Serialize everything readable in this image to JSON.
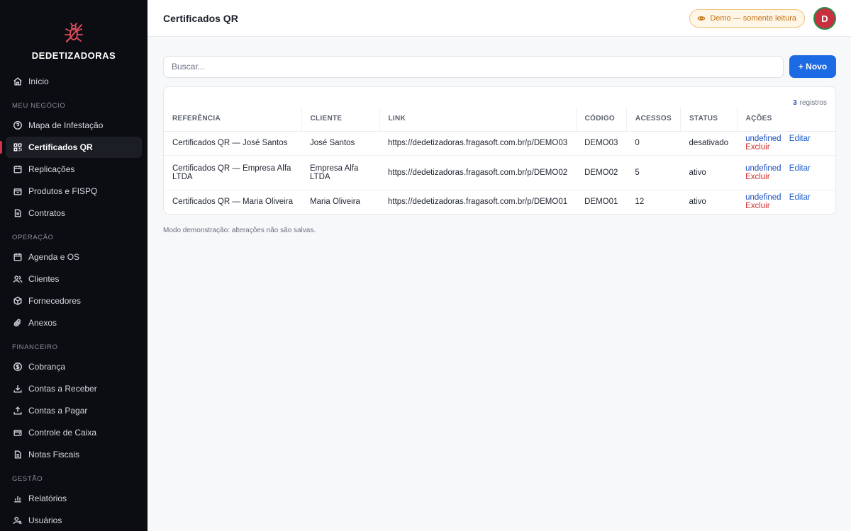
{
  "brand": {
    "name": "DEDETIZADORAS",
    "accent": "#d6314a"
  },
  "sidebar": {
    "home": {
      "label": "Início",
      "icon": "home-icon"
    },
    "sections": [
      {
        "title": "MEU NEGÓCIO",
        "items": [
          {
            "label": "Mapa de Infestação",
            "icon": "help-circle-icon"
          },
          {
            "label": "Certificados QR",
            "icon": "qr-grid-icon",
            "active": true
          },
          {
            "label": "Replicações",
            "icon": "calendar-icon"
          },
          {
            "label": "Produtos e FISPQ",
            "icon": "box-icon"
          },
          {
            "label": "Contratos",
            "icon": "file-icon"
          }
        ]
      },
      {
        "title": "OPERAÇÃO",
        "items": [
          {
            "label": "Agenda e OS",
            "icon": "calendar-icon"
          },
          {
            "label": "Clientes",
            "icon": "users-icon"
          },
          {
            "label": "Fornecedores",
            "icon": "package-icon"
          },
          {
            "label": "Anexos",
            "icon": "paperclip-icon"
          }
        ]
      },
      {
        "title": "FINANCEIRO",
        "items": [
          {
            "label": "Cobrança",
            "icon": "dollar-circle-icon"
          },
          {
            "label": "Contas a Receber",
            "icon": "download-icon"
          },
          {
            "label": "Contas a Pagar",
            "icon": "upload-icon"
          },
          {
            "label": "Controle de Caixa",
            "icon": "wallet-icon"
          },
          {
            "label": "Notas Fiscais",
            "icon": "file-icon"
          }
        ]
      },
      {
        "title": "GESTÃO",
        "items": [
          {
            "label": "Relatórios",
            "icon": "bar-chart-icon"
          },
          {
            "label": "Usuários",
            "icon": "user-key-icon"
          }
        ]
      }
    ]
  },
  "header": {
    "title": "Certificados QR",
    "demo_badge": "Demo — somente leitura",
    "avatar_initial": "D"
  },
  "toolbar": {
    "search_placeholder": "Buscar...",
    "new_label": "+ Novo"
  },
  "table": {
    "count": "3",
    "count_suffix": "registros",
    "columns": [
      "REFERÊNCIA",
      "CLIENTE",
      "LINK",
      "CÓDIGO",
      "ACESSOS",
      "STATUS",
      "AÇÕES"
    ],
    "rows": [
      {
        "ref": "Certificados QR — José Santos",
        "client": "José Santos",
        "link": "https://dedetizadoras.fragasoft.com.br/p/DEMO03",
        "code": "DEMO03",
        "accesses": "0",
        "status": "desativado",
        "a1": "undefined",
        "a2": "Editar",
        "a3": "Excluir"
      },
      {
        "ref": "Certificados QR — Empresa Alfa LTDA",
        "client": "Empresa Alfa LTDA",
        "link": "https://dedetizadoras.fragasoft.com.br/p/DEMO02",
        "code": "DEMO02",
        "accesses": "5",
        "status": "ativo",
        "a1": "undefined",
        "a2": "Editar",
        "a3": "Excluir"
      },
      {
        "ref": "Certificados QR — Maria Oliveira",
        "client": "Maria Oliveira",
        "link": "https://dedetizadoras.fragasoft.com.br/p/DEMO01",
        "code": "DEMO01",
        "accesses": "12",
        "status": "ativo",
        "a1": "undefined",
        "a2": "Editar",
        "a3": "Excluir"
      }
    ]
  },
  "footnote": "Modo demonstração: alterações não são salvas.",
  "colors": {
    "primary": "#1d6ae5",
    "danger": "#d12b2b",
    "warning": "#c07212",
    "sidebar_bg": "#0c0d12"
  }
}
